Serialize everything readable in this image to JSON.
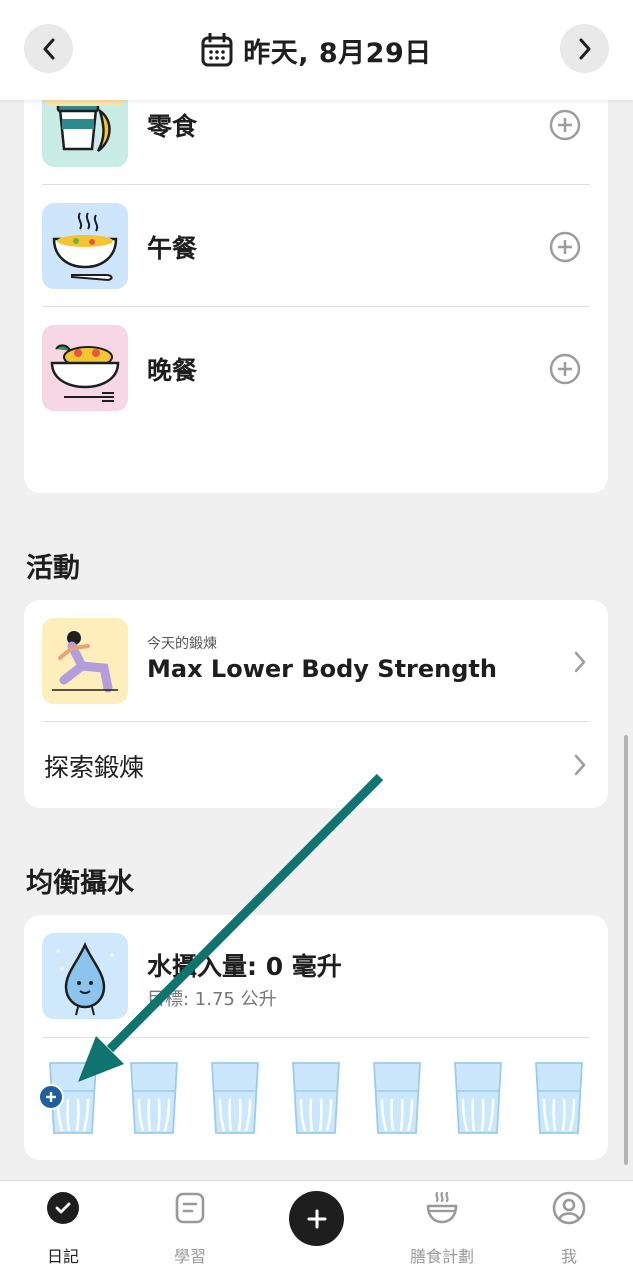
{
  "header": {
    "date_label": "昨天, 8月29日"
  },
  "meals": [
    {
      "name": "零食"
    },
    {
      "name": "午餐"
    },
    {
      "name": "晚餐"
    }
  ],
  "activity": {
    "section_title": "活動",
    "workout_caption": "今天的鍛煉",
    "workout_name": "Max Lower Body Strength",
    "explore_label": "探索鍛煉"
  },
  "water": {
    "section_title": "均衡攝水",
    "intake_label": "水攝入量: 0 毫升",
    "goal_label": "目標: 1.75 公升",
    "glasses_filled": 0,
    "glasses_total": 7
  },
  "tabs": [
    {
      "label": "日記",
      "icon": "check-circle-icon",
      "active": true
    },
    {
      "label": "學習",
      "icon": "document-icon",
      "active": false
    },
    {
      "label": "膳食計劃",
      "icon": "bowl-icon",
      "active": false
    },
    {
      "label": "我",
      "icon": "profile-icon",
      "active": false
    }
  ],
  "colors": {
    "snack_bg": "#c9ece6",
    "lunch_bg": "#cde6fb",
    "dinner_bg": "#f7d7e3",
    "workout_bg": "#fdeebc",
    "water_bg": "#cfe8fb",
    "glass_fill": "#cbe7fb",
    "annotation_arrow": "#0f7470",
    "plus_badge": "#1f5fa1"
  }
}
